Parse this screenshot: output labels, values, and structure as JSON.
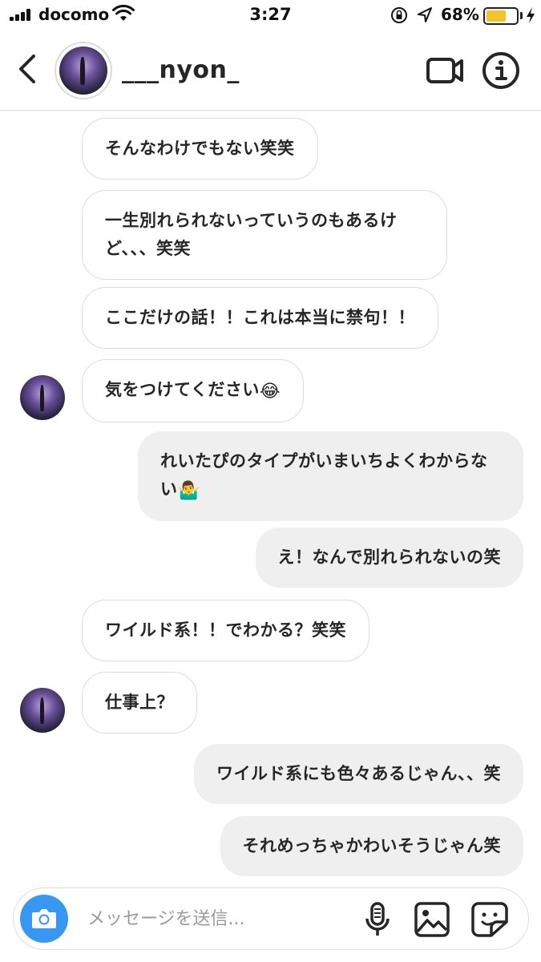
{
  "status_bar": {
    "carrier": "docomo",
    "time": "3:27",
    "battery_percent": "68%",
    "battery_level": 0.68,
    "icons": [
      "signal-icon",
      "wifi-icon",
      "orientation-lock-icon",
      "location-icon",
      "battery-icon",
      "charging-icon"
    ]
  },
  "header": {
    "username": "___nyon_",
    "icons": [
      "back-chevron-icon",
      "video-call-icon",
      "info-icon"
    ]
  },
  "messages": [
    {
      "side": "received",
      "text": "そんなわけでもない笑笑"
    },
    {
      "side": "received",
      "text": "一生別れられないっていうのもあるけど、、、笑笑"
    },
    {
      "side": "received",
      "text": "ここだけの話！！これは本当に禁句！！"
    },
    {
      "side": "received",
      "text": "気をつけてください",
      "emoji": "😂"
    },
    {
      "side": "sent",
      "text": "れいたぴのタイプがいまいちよくわからない",
      "emoji": "🤷‍♂️"
    },
    {
      "side": "sent",
      "text": "え！なんで別れられないの笑"
    },
    {
      "side": "received",
      "text": "ワイルド系！！でわかる？笑笑"
    },
    {
      "side": "received",
      "text": "仕事上？"
    },
    {
      "side": "sent",
      "text": "ワイルド系にも色々あるじゃん、、笑"
    },
    {
      "side": "sent",
      "text": "それめっちゃかわいそうじゃん笑"
    }
  ],
  "composer": {
    "placeholder": "メッセージを送信...",
    "value": "",
    "icons": [
      "camera-icon",
      "microphone-icon",
      "gallery-icon",
      "sticker-icon"
    ]
  },
  "colors": {
    "accent_blue": "#3897f0",
    "sent_bubble": "#efefef",
    "received_border": "#dcdcdc",
    "battery": "#f3c32a"
  }
}
